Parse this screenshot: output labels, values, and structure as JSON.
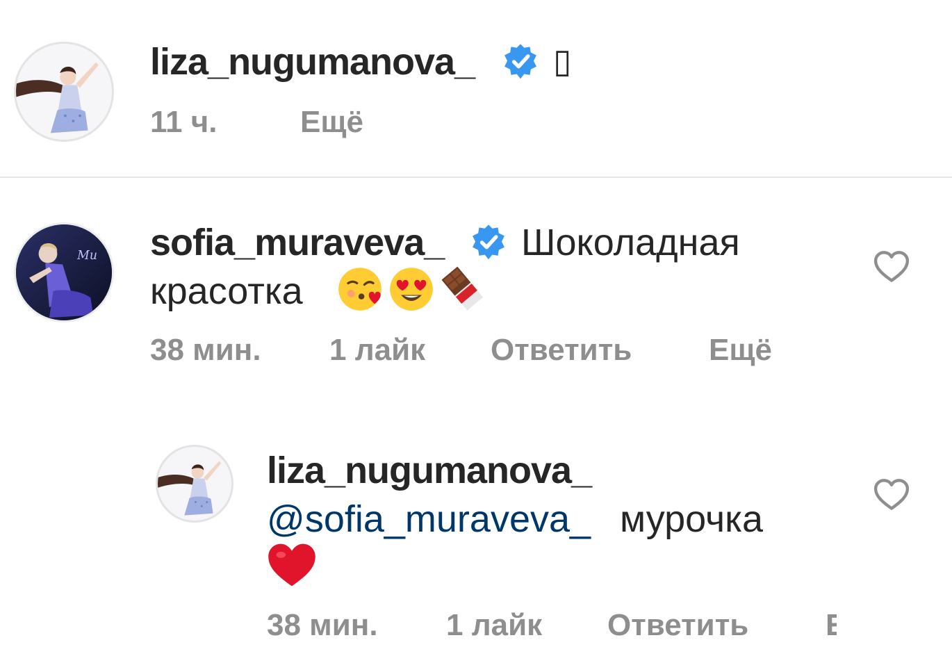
{
  "caption": {
    "username": "liza_nugumanova_",
    "verified": true,
    "trailing_glyph": "▯",
    "time": "11 ч.",
    "more": "Ещё"
  },
  "comments": [
    {
      "username": "sofia_muraveva_",
      "verified": true,
      "text_line1": "Шоколадная",
      "text_line2": "красотка",
      "emojis": [
        "kissing-heart-emoji",
        "heart-eyes-emoji",
        "chocolate-bar-emoji"
      ],
      "time": "38 мин.",
      "likes": "1 лайк",
      "reply": "Ответить",
      "more": "Ещё"
    }
  ],
  "replies": [
    {
      "username": "liza_nugumanova_",
      "mention": "@sofia_muraveva_",
      "text": "мурочка",
      "emojis": [
        "red-heart-emoji"
      ],
      "time": "38 мин.",
      "likes": "1 лайк",
      "reply": "Ответить",
      "more": "Ещё"
    }
  ],
  "colors": {
    "verified_blue": "#3897f0",
    "meta_gray": "#8e8e8e",
    "mention_blue": "#00376b",
    "heart_red": "#e0142b"
  }
}
